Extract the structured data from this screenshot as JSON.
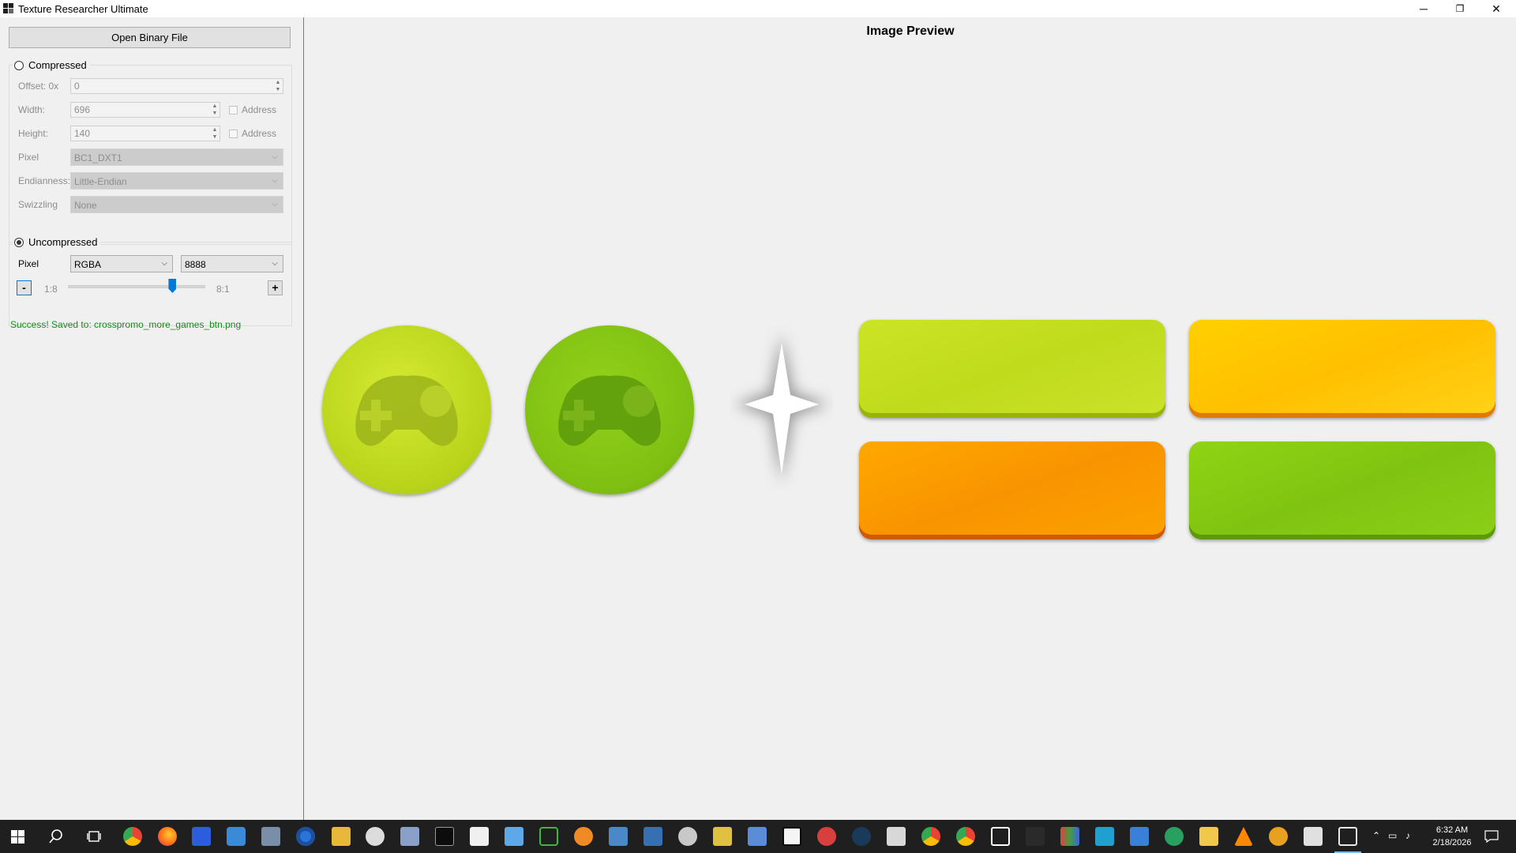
{
  "window": {
    "title": "Texture Researcher Ultimate"
  },
  "controls": {
    "minimize": "─",
    "maximize": "❐",
    "close": "✕"
  },
  "left": {
    "open_button": "Open Binary File",
    "compressed": {
      "label": "Compressed",
      "selected": false,
      "offset_label": "Offset: 0x",
      "offset_value": "0",
      "width_label": "Width:",
      "width_value": "696",
      "height_label": "Height:",
      "height_value": "140",
      "address_label": "Address",
      "pixel_label": "Pixel",
      "pixel_value": "BC1_DXT1",
      "endian_label": "Endianness:",
      "endian_value": "Little-Endian",
      "swizzle_label": "Swizzling",
      "swizzle_value": "None"
    },
    "uncompressed": {
      "label": "Uncompressed",
      "selected": true,
      "pixel_label": "Pixel",
      "format_value": "RGBA",
      "bits_value": "8888",
      "minus": "-",
      "plus": "+",
      "zoom_min": "1:8",
      "zoom_max": "8:1",
      "zoom_level": 0.77
    },
    "status": "Success! Saved to: crosspromo_more_games_btn.png"
  },
  "preview": {
    "title": "Image Preview"
  },
  "taskbar": {
    "time": "6:32 AM",
    "date": "2/18/2026"
  },
  "colors": {
    "accent": "#0078d7",
    "status_green": "#1a8a1a",
    "btn_lime": "#c2dc1e",
    "btn_green": "#84c513",
    "btn_yellow": "#ffc800",
    "btn_orange": "#f99600"
  }
}
